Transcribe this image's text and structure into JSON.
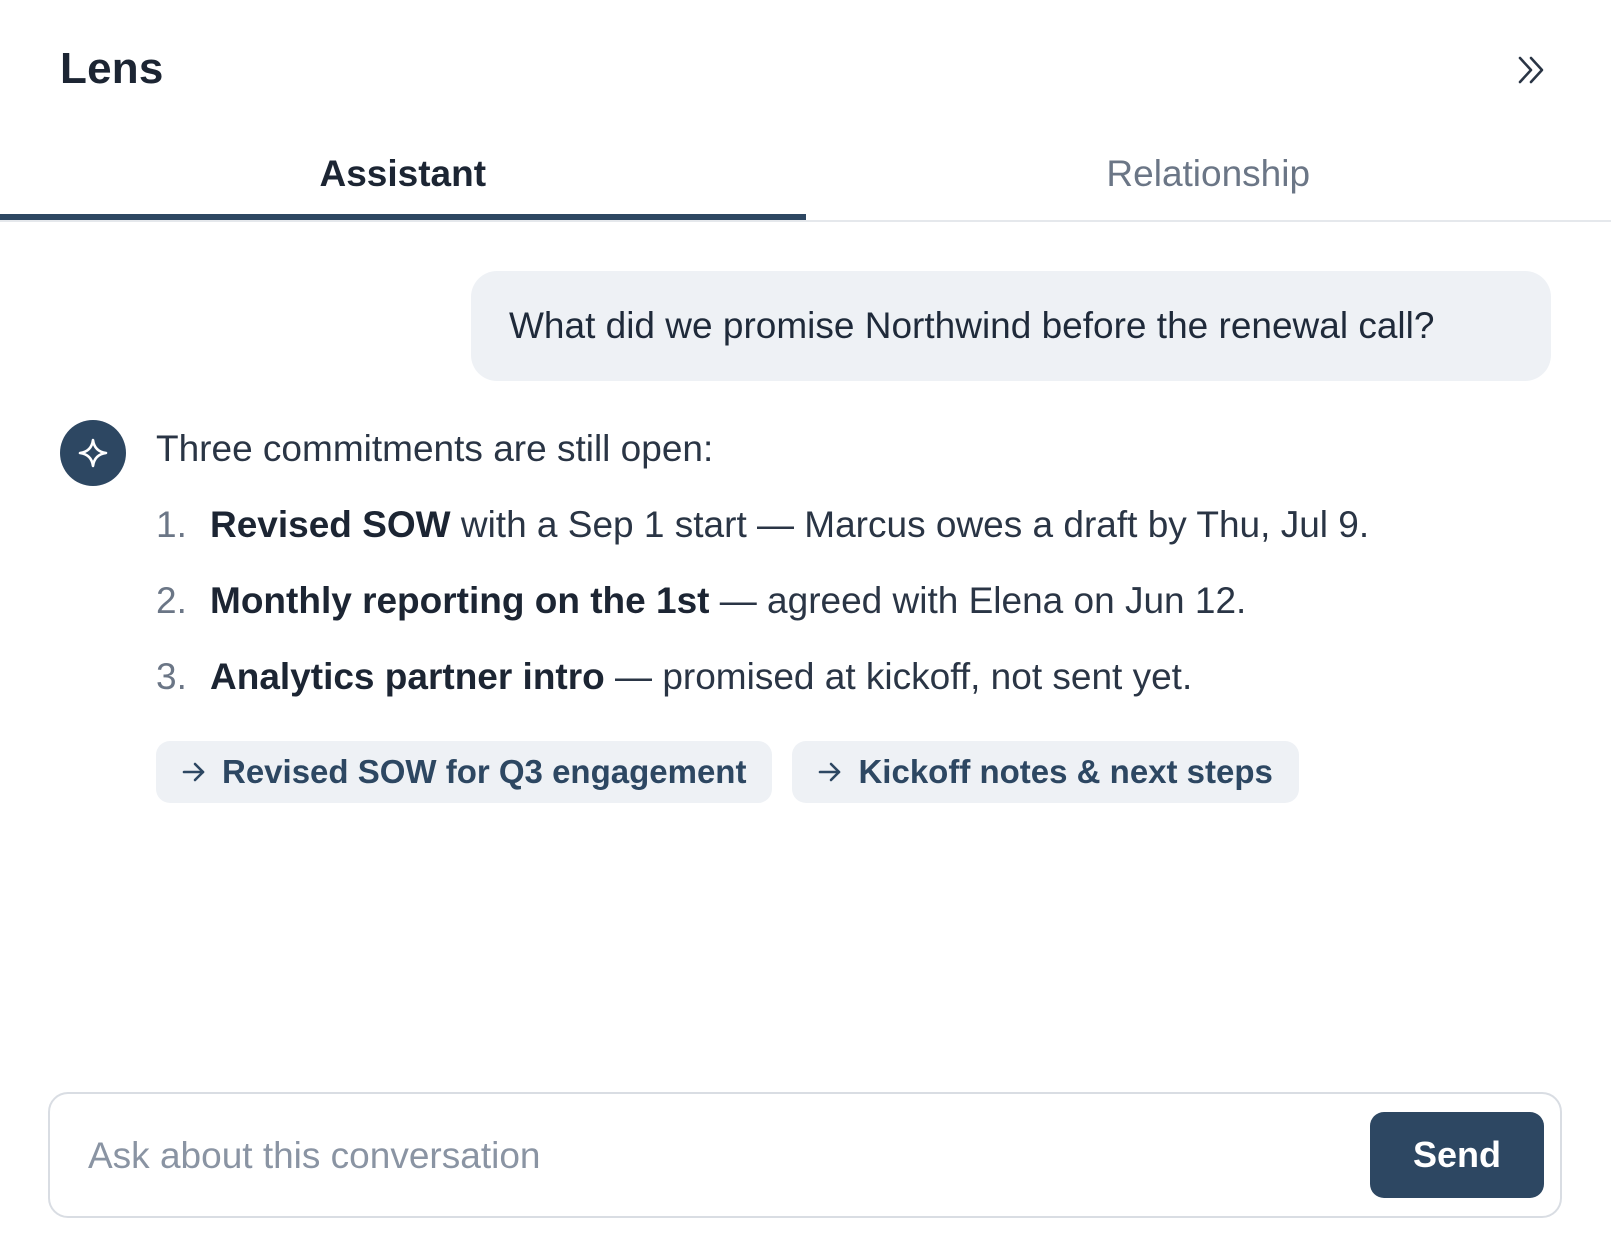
{
  "header": {
    "title": "Lens",
    "collapse_icon": "double-chevron-right-icon"
  },
  "tabs": [
    {
      "label": "Assistant",
      "active": true
    },
    {
      "label": "Relationship",
      "active": false
    }
  ],
  "conversation": {
    "user_message": "What did we promise Northwind before the renewal call?",
    "assistant": {
      "avatar_icon": "sparkle-icon",
      "intro": "Three commitments are still open:",
      "items": [
        {
          "number": "1.",
          "bold": "Revised SOW",
          "rest": " with a Sep 1 start — Marcus owes a draft by Thu, Jul 9."
        },
        {
          "number": "2.",
          "bold": "Monthly reporting on the 1st",
          "rest": " — agreed with Elena on Jun 12."
        },
        {
          "number": "3.",
          "bold": "Analytics partner intro",
          "rest": " — promised at kickoff, not sent yet."
        }
      ],
      "sources": [
        {
          "label": "Revised SOW for Q3 engagement",
          "icon": "arrow-right-icon"
        },
        {
          "label": "Kickoff notes & next steps",
          "icon": "arrow-right-icon"
        }
      ]
    }
  },
  "composer": {
    "placeholder": "Ask about this conversation",
    "value": "",
    "send_label": "Send"
  },
  "colors": {
    "accent": "#2d4762",
    "bubble": "#eef1f5",
    "muted_text": "#6b7686"
  }
}
